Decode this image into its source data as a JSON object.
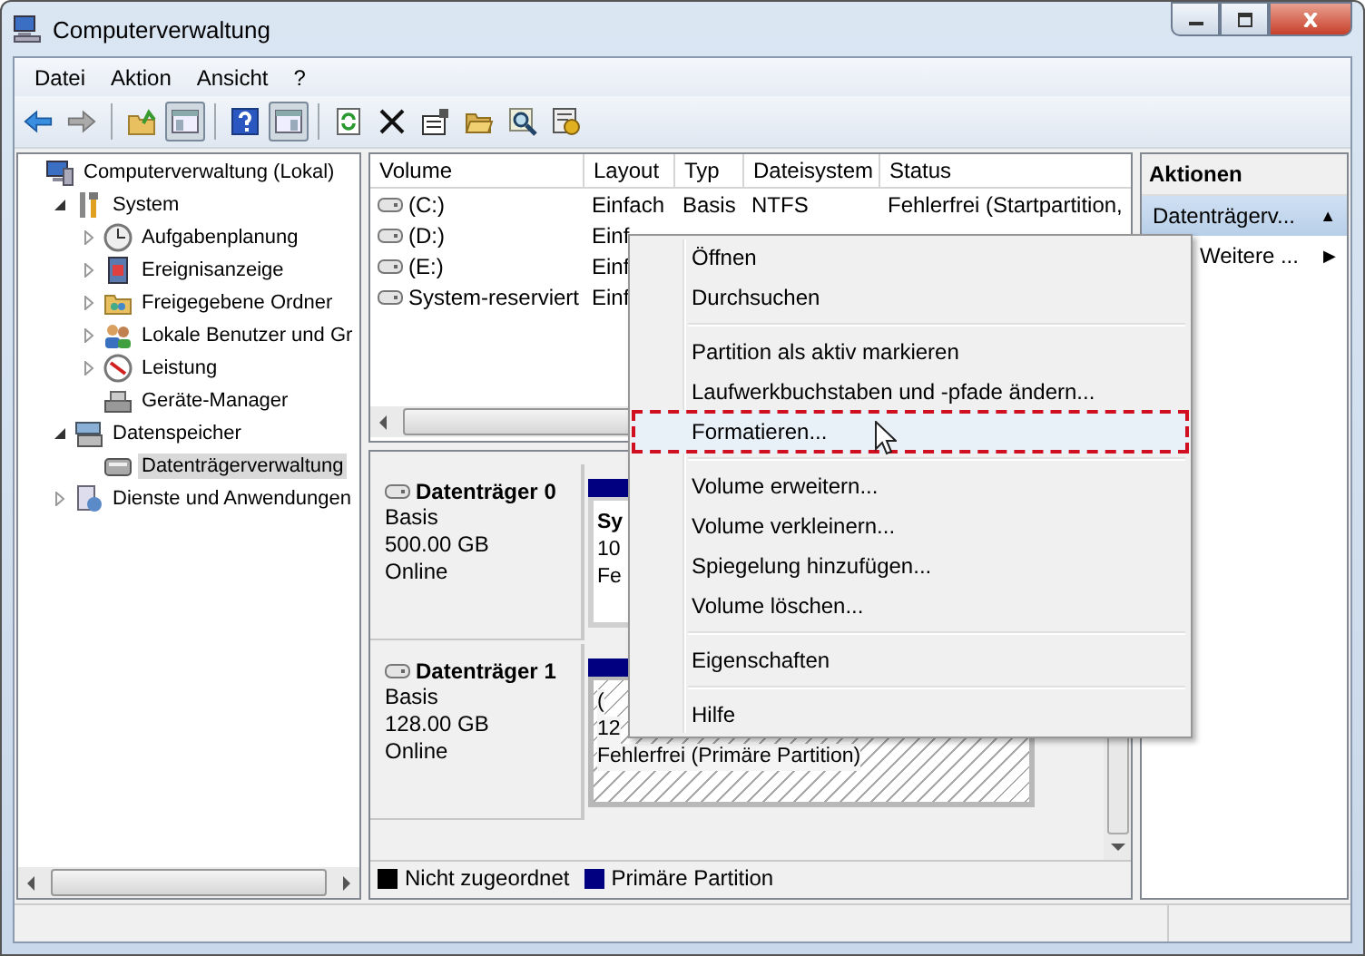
{
  "window": {
    "title": "Computerverwaltung"
  },
  "menu": [
    "Datei",
    "Aktion",
    "Ansicht",
    "?"
  ],
  "toolbar": [
    {
      "kind": "back",
      "pressed": false
    },
    {
      "kind": "forward",
      "pressed": false
    },
    {
      "kind": "sep"
    },
    {
      "kind": "up",
      "pressed": false
    },
    {
      "kind": "tree",
      "pressed": true
    },
    {
      "kind": "sep"
    },
    {
      "kind": "help",
      "pressed": false
    },
    {
      "kind": "pane",
      "pressed": true
    },
    {
      "kind": "sep"
    },
    {
      "kind": "refresh",
      "pressed": false
    },
    {
      "kind": "delete",
      "pressed": false
    },
    {
      "kind": "properties",
      "pressed": false
    },
    {
      "kind": "open",
      "pressed": false
    },
    {
      "kind": "search",
      "pressed": false
    },
    {
      "kind": "settings",
      "pressed": false
    }
  ],
  "tree": [
    {
      "label": "Computerverwaltung (Lokal)",
      "selected": false,
      "children": [
        {
          "label": "System",
          "expanded": true,
          "selected": false,
          "children": [
            {
              "label": "Aufgabenplanung",
              "expanded": false,
              "selected": false
            },
            {
              "label": "Ereignisanzeige",
              "expanded": false,
              "selected": false
            },
            {
              "label": "Freigegebene Ordner",
              "expanded": false,
              "selected": false
            },
            {
              "label": "Lokale Benutzer und Gr",
              "expanded": false,
              "selected": false
            },
            {
              "label": "Leistung",
              "expanded": false,
              "selected": false
            },
            {
              "label": "Geräte-Manager",
              "selected": false
            }
          ]
        },
        {
          "label": "Datenspeicher",
          "expanded": true,
          "selected": false,
          "children": [
            {
              "label": "Datenträgerverwaltung",
              "selected": true
            }
          ]
        },
        {
          "label": "Dienste und Anwendungen",
          "expanded": false,
          "selected": false
        }
      ]
    }
  ],
  "volumes": {
    "columns": [
      "Volume",
      "Layout",
      "Typ",
      "Dateisystem",
      "Status"
    ],
    "rows": [
      [
        "(C:)",
        "Einfach",
        "Basis",
        "NTFS",
        "Fehlerfrei (Startpartition,"
      ],
      [
        "(D:)",
        "Einf"
      ],
      [
        "(E:)",
        "Einf"
      ],
      [
        "System-reserviert",
        "Einf"
      ]
    ]
  },
  "disks": [
    {
      "name": "Datenträger 0",
      "type": "Basis",
      "size": "500.00 GB",
      "status": "Online",
      "partition": {
        "hatched": false,
        "lines": [
          "Sy",
          "10",
          "Fe"
        ]
      }
    },
    {
      "name": "Datenträger 1",
      "type": "Basis",
      "size": "128.00 GB",
      "status": "Online",
      "partition": {
        "hatched": true,
        "lines": [
          "(",
          "12",
          "Fehlerfrei (Primäre Partition)"
        ]
      }
    }
  ],
  "legend": [
    {
      "label": "Nicht zugeordnet",
      "color": "#000000"
    },
    {
      "label": "Primäre Partition",
      "color": "#000080"
    }
  ],
  "actions": {
    "title": "Aktionen",
    "items": [
      {
        "label": "Datenträgerv...",
        "arrow": "▲",
        "selected": true
      },
      {
        "label": "Weitere ...",
        "arrow": "▶",
        "selected": false
      }
    ]
  },
  "context_menu": {
    "groups": [
      [
        {
          "label": "Öffnen",
          "selected": false
        },
        {
          "label": "Durchsuchen",
          "selected": false
        }
      ],
      [
        {
          "label": "Partition als aktiv markieren",
          "selected": false
        },
        {
          "label": "Laufwerkbuchstaben und -pfade ändern...",
          "selected": false
        },
        {
          "label": "Formatieren...",
          "selected": true
        }
      ],
      [
        {
          "label": "Volume erweitern...",
          "selected": false
        },
        {
          "label": "Volume verkleinern...",
          "selected": false
        },
        {
          "label": "Spiegelung hinzufügen...",
          "selected": false
        },
        {
          "label": "Volume löschen...",
          "selected": false
        }
      ],
      [
        {
          "label": "Eigenschaften",
          "selected": false
        }
      ],
      [
        {
          "label": "Hilfe",
          "selected": false
        }
      ]
    ]
  }
}
